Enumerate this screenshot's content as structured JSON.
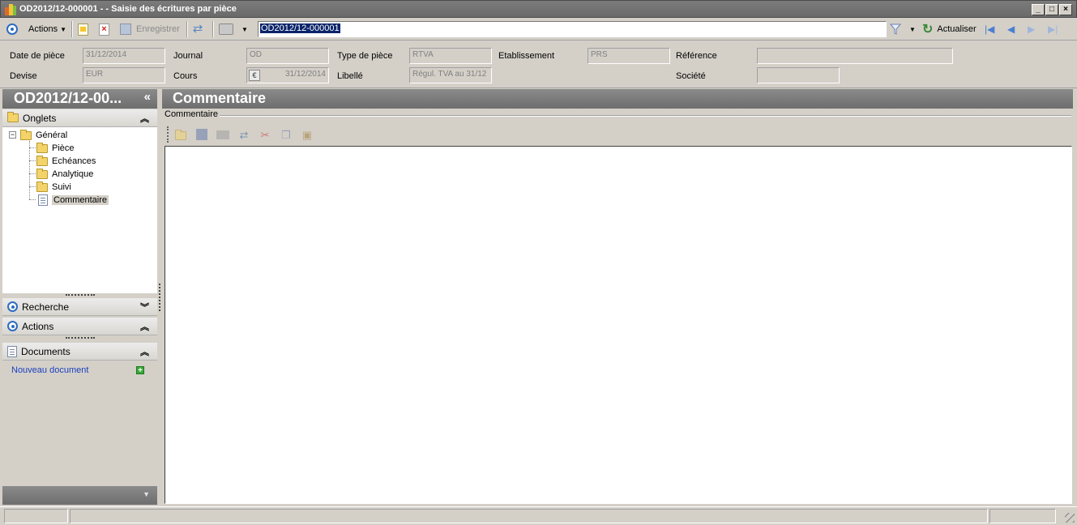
{
  "window": {
    "title": "OD2012/12-000001 -  -  Saisie des écritures par pièce",
    "minimize": "_",
    "maximize": "□",
    "close": "×"
  },
  "toolbar": {
    "actions_label": "Actions",
    "save_label": "Enregistrer",
    "search_value": "OD2012/12-000001",
    "refresh_label": "Actualiser"
  },
  "header": {
    "date_piece_label": "Date de pièce",
    "date_piece_value": "31/12/2014",
    "journal_label": "Journal",
    "journal_value": "OD",
    "type_piece_label": "Type de pièce",
    "type_piece_value": "RTVA",
    "etablissement_label": "Etablissement",
    "etablissement_value": "PRS",
    "reference_label": "Référence",
    "reference_value": "",
    "devise_label": "Devise",
    "devise_value": "EUR",
    "cours_label": "Cours",
    "cours_symbol": "€",
    "cours_value": "31/12/2014",
    "libelle_label": "Libellé",
    "libelle_value": "Régul. TVA au 31/12",
    "societe_label": "Société",
    "societe_value": ""
  },
  "left_panel": {
    "title": "OD2012/12-00...",
    "collapse_glyph": "«",
    "onglets_label": "Onglets",
    "tree": {
      "root": "Général",
      "items": [
        "Pièce",
        "Echéances",
        "Analytique",
        "Suivi",
        "Commentaire"
      ]
    },
    "recherche_label": "Recherche",
    "actions_label": "Actions",
    "documents_label": "Documents",
    "new_document_label": "Nouveau document"
  },
  "main": {
    "title": "Commentaire",
    "group_label": "Commentaire",
    "comment_text": ""
  },
  "icons": {
    "accent": "#2e6cc0",
    "title_bar": "#6e6e6e",
    "link": "#1a3fc0"
  }
}
